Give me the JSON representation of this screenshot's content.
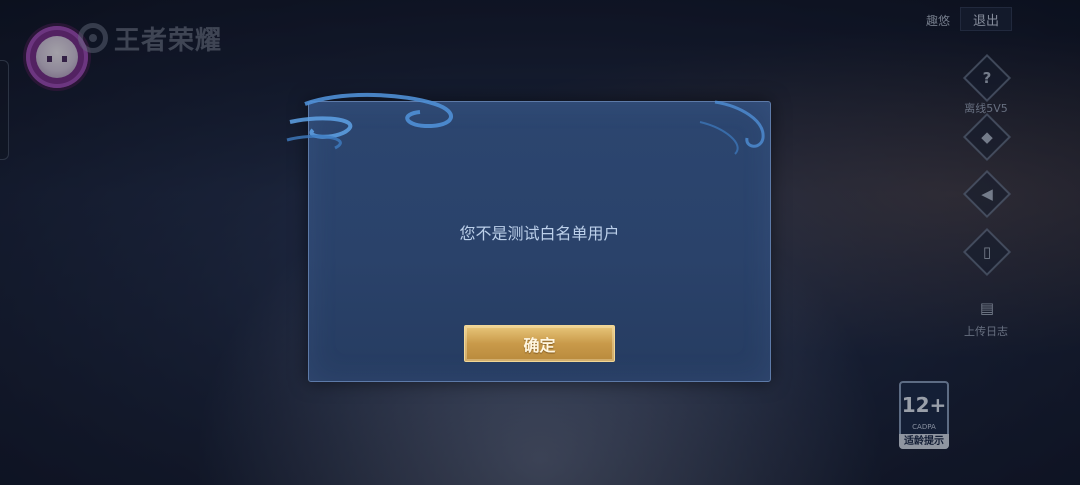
{
  "header": {
    "logo_text": "王者荣耀",
    "user_name": "趣悠",
    "logout_label": "退出"
  },
  "sidebar": {
    "items": [
      {
        "icon": "help-icon",
        "glyph": "?",
        "label": "离线5V5"
      },
      {
        "icon": "gamepad-icon",
        "glyph": "◆",
        "label": ""
      },
      {
        "icon": "speaker-icon",
        "glyph": "◀",
        "label": ""
      },
      {
        "icon": "phone-icon",
        "glyph": "▯",
        "label": ""
      },
      {
        "icon": "clipboard-icon",
        "glyph": "▤",
        "label": "上传日志"
      }
    ]
  },
  "age_rating": {
    "value": "12+",
    "org": "CADPA",
    "tip": "适龄提示"
  },
  "dialog": {
    "message": "您不是测试白名单用户",
    "confirm_label": "确定"
  }
}
